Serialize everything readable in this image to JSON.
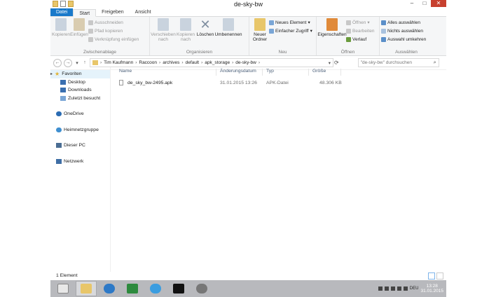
{
  "window": {
    "title": "de-sky-bw"
  },
  "tabs": [
    "Datei",
    "Start",
    "Freigeben",
    "Ansicht"
  ],
  "ribbon": {
    "clipboard": {
      "label": "Zwischenablage",
      "copy": "Kopieren",
      "paste": "Einfügen",
      "cut": "Ausschneiden",
      "copy_path": "Pfad kopieren",
      "paste_shortcut": "Verknüpfung einfügen"
    },
    "organize": {
      "label": "Organisieren",
      "move_to": [
        "Verschieben",
        "nach"
      ],
      "copy_to": [
        "Kopieren",
        "nach"
      ],
      "delete": "Löschen",
      "rename": "Umbenennen"
    },
    "new": {
      "label": "Neu",
      "new_folder": [
        "Neuer",
        "Ordner"
      ],
      "new_item": "Neues Element",
      "easy_access": "Einfacher Zugriff"
    },
    "open": {
      "label": "Öffnen",
      "properties": "Eigenschaften",
      "open": "Öffnen",
      "edit": "Bearbeiten",
      "history": "Verlauf"
    },
    "select": {
      "label": "Auswählen",
      "select_all": "Alles auswählen",
      "select_none": "Nichts auswählen",
      "invert": "Auswahl umkehren"
    }
  },
  "address": {
    "path": [
      "Tim Kaufmann",
      "Raccoon",
      "archives",
      "default",
      "apk_storage",
      "de-sky-bw"
    ],
    "search_placeholder": "\"de-sky-bw\" durchsuchen"
  },
  "nav": {
    "favorites": "Favoriten",
    "desktop": "Desktop",
    "downloads": "Downloads",
    "recent": "Zuletzt besucht",
    "onedrive": "OneDrive",
    "homegroup": "Heimnetzgruppe",
    "this_pc": "Dieser PC",
    "network": "Netzwerk"
  },
  "columns": {
    "name": "Name",
    "date": "Änderungsdatum",
    "type": "Typ",
    "size": "Größe"
  },
  "files": [
    {
      "name": "de_sky_bw-2495.apk",
      "date": "31.01.2015 13:26",
      "type": "APK-Datei",
      "size": "48.306 KB"
    }
  ],
  "status": {
    "count": "1 Element"
  },
  "taskbar": {
    "lang": "DEU",
    "time": "13:28",
    "date": "31.01.2015"
  },
  "colors": {
    "file_tab": "#1979ca",
    "close": "#c7402f",
    "taskbar": "#b8b9bd"
  }
}
